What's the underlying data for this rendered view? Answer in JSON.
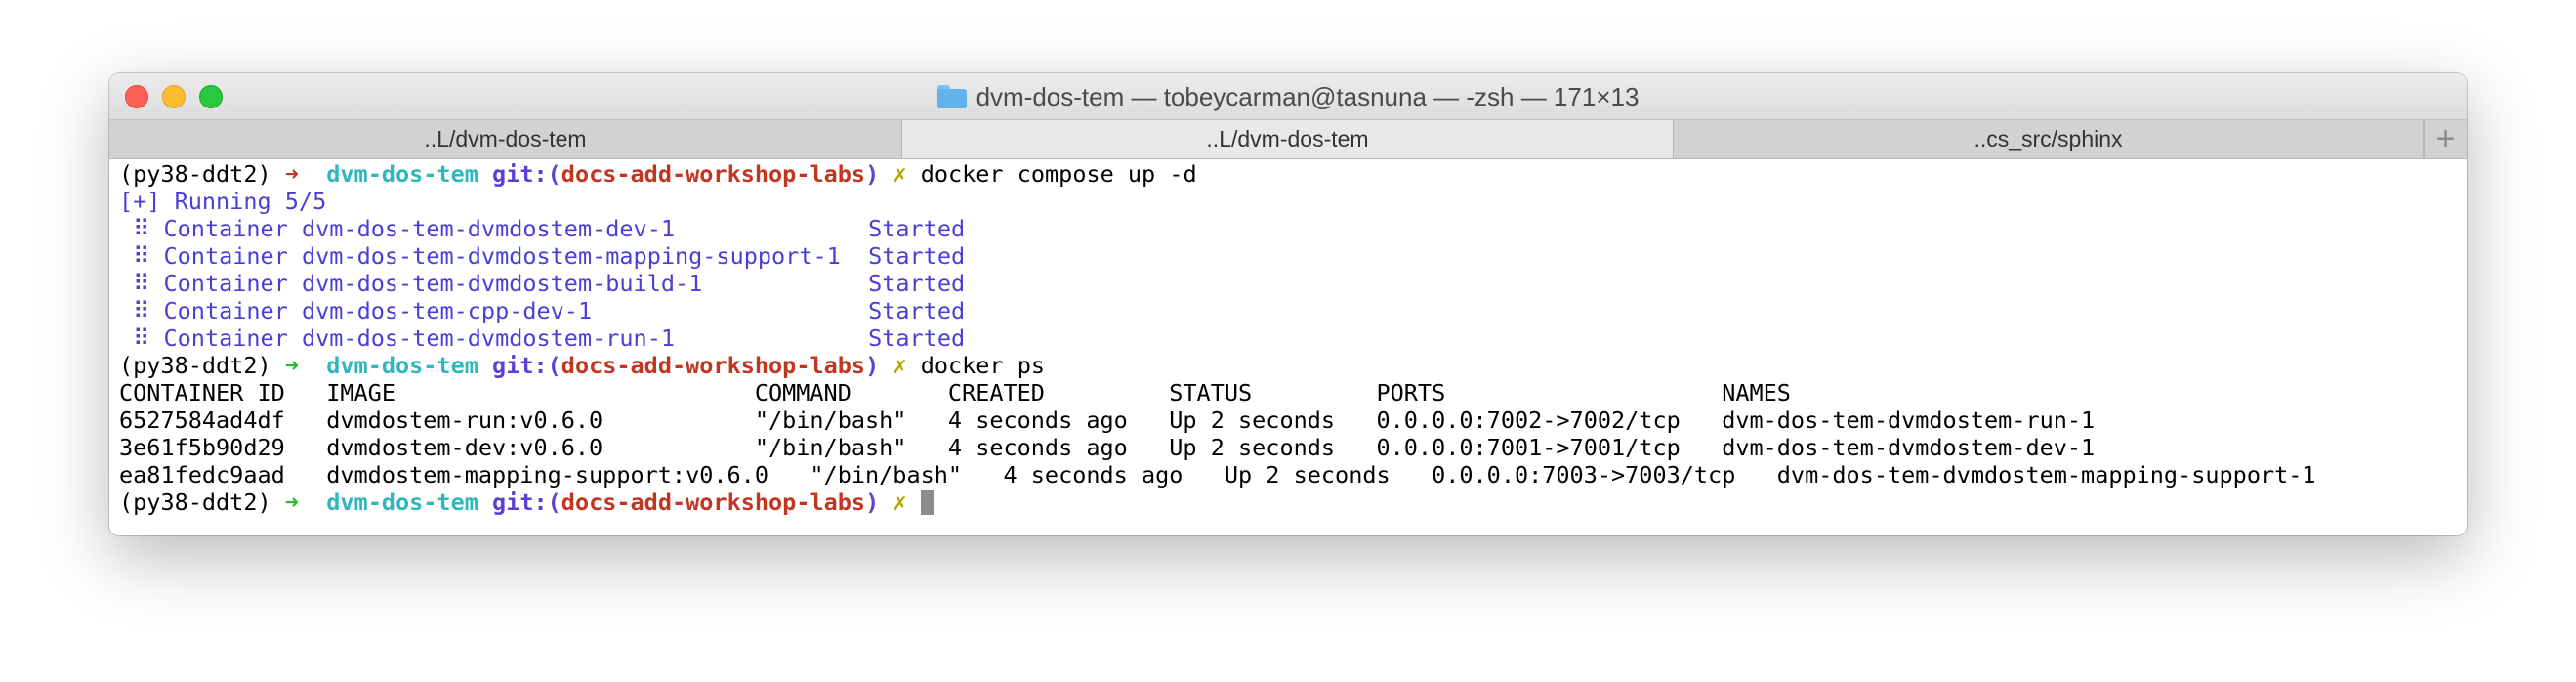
{
  "window": {
    "title": "dvm-dos-tem — tobeycarman@tasnuna — -zsh — 171×13",
    "folder_icon": "folder-icon"
  },
  "tabs": [
    {
      "label": "..L/dvm-dos-tem",
      "active": false
    },
    {
      "label": "..L/dvm-dos-tem",
      "active": true
    },
    {
      "label": "..cs_src/sphinx",
      "active": false
    }
  ],
  "tab_add_label": "+",
  "prompt": {
    "env": "(py38-ddt2)",
    "arrow": "➜",
    "dir": "dvm-dos-tem",
    "git_label": "git:(",
    "branch": "docs-add-workshop-labs",
    "git_close": ")",
    "dirty": "✗"
  },
  "commands": {
    "compose": "docker compose up -d",
    "ps": "docker ps"
  },
  "compose_output": {
    "running": "[+] Running 5/5",
    "containers": [
      {
        "text": " ⠿ Container dvm-dos-tem-dvmdostem-dev-1              ",
        "status": "Started"
      },
      {
        "text": " ⠿ Container dvm-dos-tem-dvmdostem-mapping-support-1  ",
        "status": "Started"
      },
      {
        "text": " ⠿ Container dvm-dos-tem-dvmdostem-build-1            ",
        "status": "Started"
      },
      {
        "text": " ⠿ Container dvm-dos-tem-cpp-dev-1                    ",
        "status": "Started"
      },
      {
        "text": " ⠿ Container dvm-dos-tem-dvmdostem-run-1              ",
        "status": "Started"
      }
    ]
  },
  "ps_output": {
    "header": "CONTAINER ID   IMAGE                          COMMAND       CREATED         STATUS         PORTS                    NAMES",
    "rows": [
      "6527584ad4df   dvmdostem-run:v0.6.0           \"/bin/bash\"   4 seconds ago   Up 2 seconds   0.0.0.0:7002->7002/tcp   dvm-dos-tem-dvmdostem-run-1",
      "3e61f5b90d29   dvmdostem-dev:v0.6.0           \"/bin/bash\"   4 seconds ago   Up 2 seconds   0.0.0.0:7001->7001/tcp   dvm-dos-tem-dvmdostem-dev-1",
      "ea81fedc9aad   dvmdostem-mapping-support:v0.6.0   \"/bin/bash\"   4 seconds ago   Up 2 seconds   0.0.0.0:7003->7003/tcp   dvm-dos-tem-dvmdostem-mapping-support-1"
    ]
  },
  "colors": {
    "arrow_error": "#c23621",
    "arrow_ok": "#25bc24",
    "dir": "#2fb7bd",
    "git": "#5d3fd3",
    "info": "#4a3ed6"
  }
}
